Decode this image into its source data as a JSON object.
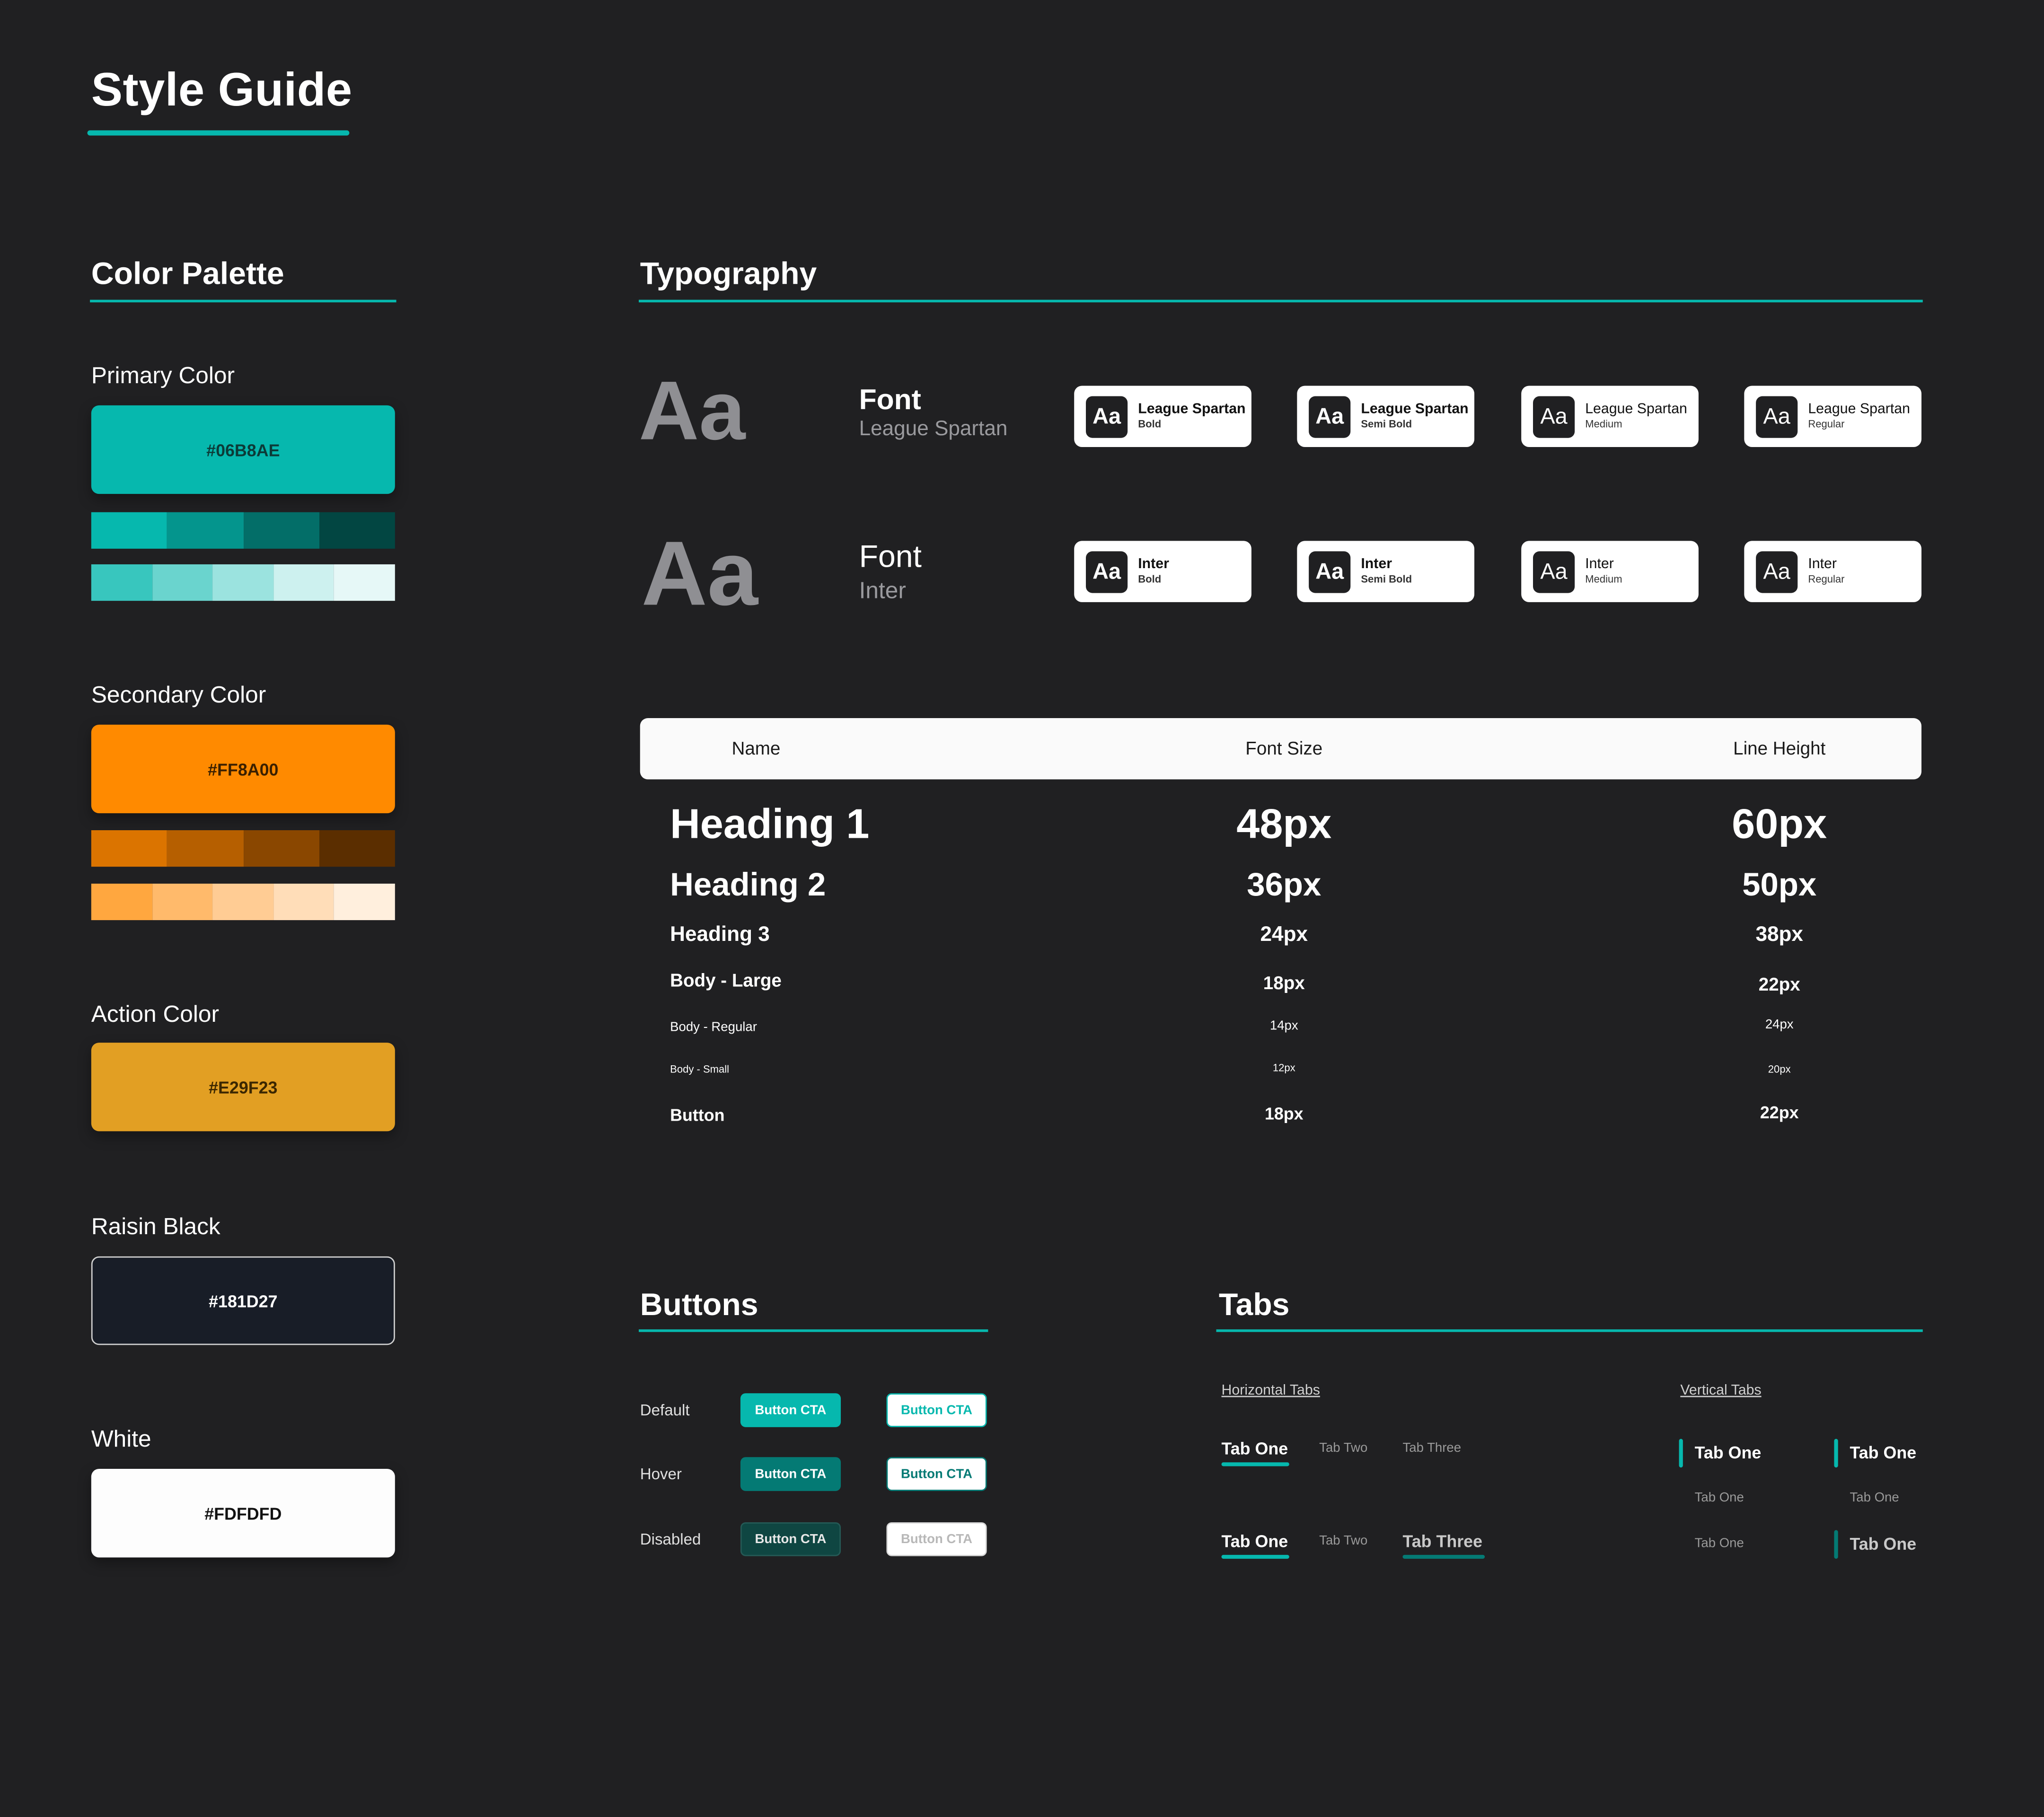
{
  "page": {
    "title": "Style Guide"
  },
  "color_palette": {
    "title": "Color Palette",
    "primary": {
      "label": "Primary Color",
      "hex": "#06B8AE",
      "dark_shades": [
        "#06B8AE",
        "#04958D",
        "#036E68",
        "#024642"
      ],
      "light_tints": [
        "#38C6BE",
        "#6AD4CE",
        "#9BE3DF",
        "#CDF1EF",
        "#E6F8F7"
      ]
    },
    "secondary": {
      "label": "Secondary Color",
      "hex": "#FF8A00",
      "dark_shades": [
        "#DB7400",
        "#B65F00",
        "#8A4700",
        "#5B2E00"
      ],
      "light_tints": [
        "#FFA73F",
        "#FFBA6B",
        "#FFCC94",
        "#FFDDB8",
        "#FFEFDD"
      ]
    },
    "action": {
      "label": "Action Color",
      "hex": "#E29F23"
    },
    "raisin": {
      "label": "Raisin Black",
      "hex": "#181D27"
    },
    "white": {
      "label": "White",
      "hex": "#FDFDFD"
    }
  },
  "typography": {
    "title": "Typography",
    "sample": "Aa",
    "fonts": [
      {
        "label": "Font",
        "name": "League Spartan",
        "weights": [
          {
            "family": "League Spartan",
            "weight": "Bold"
          },
          {
            "family": "League Spartan",
            "weight": "Semi Bold"
          },
          {
            "family": "League Spartan",
            "weight": "Medium"
          },
          {
            "family": "League Spartan",
            "weight": "Regular"
          }
        ]
      },
      {
        "label": "Font",
        "name": "Inter",
        "weights": [
          {
            "family": "Inter",
            "weight": "Bold"
          },
          {
            "family": "Inter",
            "weight": "Semi Bold"
          },
          {
            "family": "Inter",
            "weight": "Medium"
          },
          {
            "family": "Inter",
            "weight": "Regular"
          }
        ]
      }
    ],
    "table": {
      "headers": [
        "Name",
        "Font Size",
        "Line Height"
      ],
      "rows": [
        {
          "name": "Heading 1",
          "size": "48px",
          "line": "60px"
        },
        {
          "name": "Heading 2",
          "size": "36px",
          "line": "50px"
        },
        {
          "name": "Heading 3",
          "size": "24px",
          "line": "38px"
        },
        {
          "name": "Body - Large",
          "size": "18px",
          "line": "22px"
        },
        {
          "name": "Body - Regular",
          "size": "14px",
          "line": "24px"
        },
        {
          "name": "Body - Small",
          "size": "12px",
          "line": "20px"
        },
        {
          "name": "Button",
          "size": "18px",
          "line": "22px"
        }
      ]
    }
  },
  "buttons": {
    "title": "Buttons",
    "cta": "Button CTA",
    "states": [
      "Default",
      "Hover",
      "Disabled"
    ]
  },
  "tabs": {
    "title": "Tabs",
    "horizontal_label": "Horizontal Tabs",
    "vertical_label": "Vertical Tabs",
    "h_row1": [
      "Tab One",
      "Tab Two",
      "Tab Three"
    ],
    "h_row2": [
      "Tab One",
      "Tab Two",
      "Tab Three"
    ],
    "v_col1": [
      "Tab One",
      "Tab One",
      "Tab One"
    ],
    "v_col2": [
      "Tab One",
      "Tab One",
      "Tab One"
    ]
  }
}
